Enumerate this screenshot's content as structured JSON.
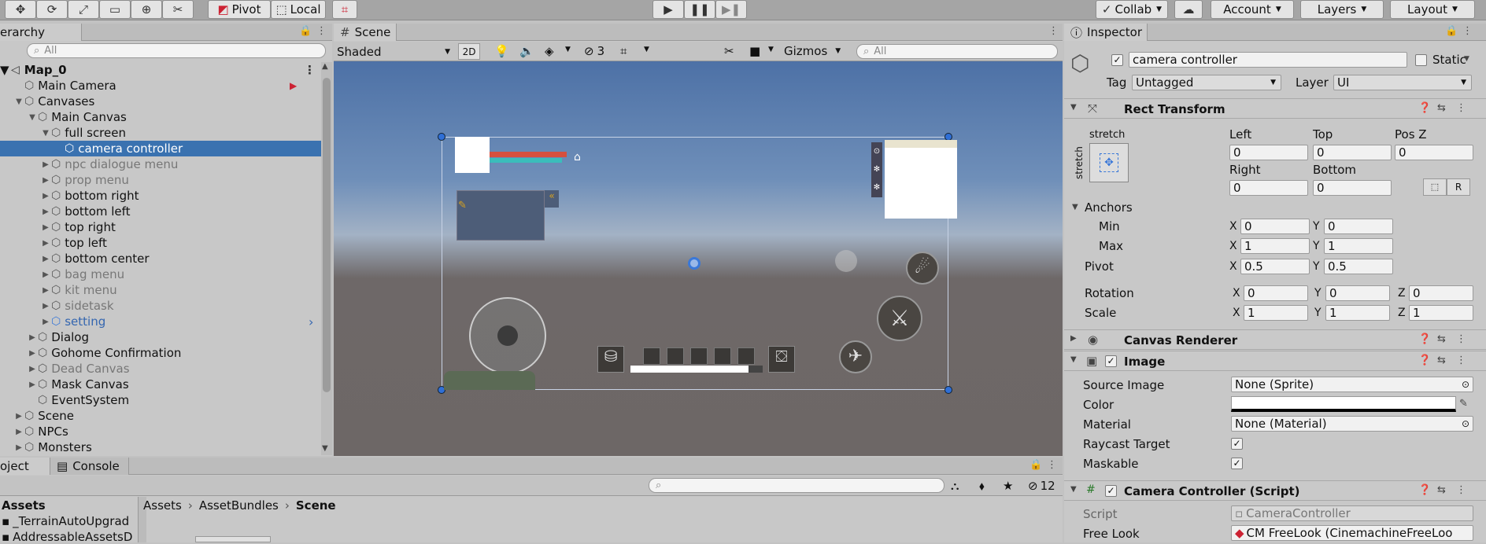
{
  "toolbar": {
    "pivot": "Pivot",
    "local": "Local",
    "collab": "Collab",
    "account": "Account",
    "layers": "Layers",
    "layout": "Layout"
  },
  "hierarchy": {
    "tab": "erarchy",
    "search_placeholder": "All",
    "scene_root": "Map_0",
    "items": [
      {
        "label": "Main Camera",
        "depth": 1
      },
      {
        "label": "Canvases",
        "depth": 1
      },
      {
        "label": "Main Canvas",
        "depth": 2
      },
      {
        "label": "full screen",
        "depth": 3
      },
      {
        "label": "camera controller",
        "depth": 4
      },
      {
        "label": "npc dialogue menu",
        "depth": 3
      },
      {
        "label": "prop menu",
        "depth": 3
      },
      {
        "label": "bottom right",
        "depth": 3
      },
      {
        "label": "bottom left",
        "depth": 3
      },
      {
        "label": "top right",
        "depth": 3
      },
      {
        "label": "top left",
        "depth": 3
      },
      {
        "label": "bottom center",
        "depth": 3
      },
      {
        "label": "bag menu",
        "depth": 3
      },
      {
        "label": "kit menu",
        "depth": 3
      },
      {
        "label": "sidetask",
        "depth": 3
      },
      {
        "label": "setting",
        "depth": 3
      },
      {
        "label": "Dialog",
        "depth": 2
      },
      {
        "label": "Gohome Confirmation",
        "depth": 2
      },
      {
        "label": "Dead Canvas",
        "depth": 2
      },
      {
        "label": "Mask Canvas",
        "depth": 2
      },
      {
        "label": "EventSystem",
        "depth": 2
      },
      {
        "label": "Scene",
        "depth": 1
      },
      {
        "label": "NPCs",
        "depth": 1
      },
      {
        "label": "Monsters",
        "depth": 1
      }
    ]
  },
  "scene": {
    "tab": "Scene",
    "shading": "Shaded",
    "mode_2d": "2D",
    "hidden_count": "3",
    "gizmos": "Gizmos",
    "search_placeholder": "All"
  },
  "project": {
    "tab_project": "oject",
    "tab_console": "Console",
    "hidden_count": "12",
    "tree_root": "Assets",
    "tree_items": [
      "_TerrainAutoUpgrad",
      "AddressableAssetsD"
    ],
    "breadcrumb": [
      "Assets",
      "AssetBundles",
      "Scene"
    ]
  },
  "inspector": {
    "tab": "Inspector",
    "object_name": "camera controller",
    "static_label": "Static",
    "tag_label": "Tag",
    "tag_value": "Untagged",
    "layer_label": "Layer",
    "layer_value": "UI",
    "rect_transform": {
      "title": "Rect Transform",
      "stretch": "stretch",
      "left_label": "Left",
      "left": "0",
      "top_label": "Top",
      "top": "0",
      "posz_label": "Pos Z",
      "posz": "0",
      "right_label": "Right",
      "right": "0",
      "bottom_label": "Bottom",
      "bottom": "0",
      "r_button": "R",
      "anchors_label": "Anchors",
      "min_label": "Min",
      "min_x": "0",
      "min_y": "0",
      "max_label": "Max",
      "max_x": "1",
      "max_y": "1",
      "pivot_label": "Pivot",
      "pivot_x": "0.5",
      "pivot_y": "0.5",
      "rotation_label": "Rotation",
      "rot_x": "0",
      "rot_y": "0",
      "rot_z": "0",
      "scale_label": "Scale",
      "scale_x": "1",
      "scale_y": "1",
      "scale_z": "1",
      "x": "X",
      "y": "Y",
      "z": "Z"
    },
    "canvas_renderer": {
      "title": "Canvas Renderer"
    },
    "image": {
      "title": "Image",
      "source_image_label": "Source Image",
      "source_image": "None (Sprite)",
      "color_label": "Color",
      "material_label": "Material",
      "material": "None (Material)",
      "raycast_label": "Raycast Target",
      "maskable_label": "Maskable"
    },
    "camera_controller": {
      "title": "Camera Controller (Script)",
      "script_label": "Script",
      "script": "CameraController",
      "freelook_label": "Free Look",
      "freelook": "CM FreeLook (CinemachineFreeLoo"
    }
  }
}
